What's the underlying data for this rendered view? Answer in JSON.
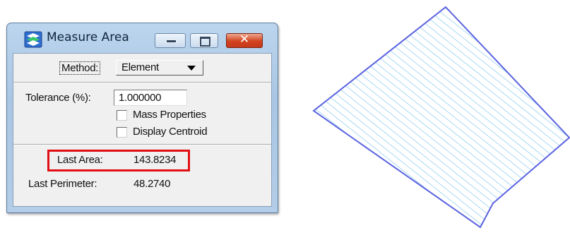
{
  "dialog": {
    "title": "Measure Area",
    "method_label": "Method:",
    "method_value": "Element",
    "tolerance_label": "Tolerance (%):",
    "tolerance_value": "1.000000",
    "mass_properties_label": "Mass Properties",
    "mass_properties_checked": false,
    "display_centroid_label": "Display Centroid",
    "display_centroid_checked": false,
    "last_area_label": "Last Area:",
    "last_area_value": "143.8234",
    "last_perimeter_label": "Last Perimeter:",
    "last_perimeter_value": "48.2740",
    "highlight_color": "#e10f13"
  },
  "window_buttons": {
    "minimize_icon": "minimize-icon",
    "maximize_icon": "maximize-icon",
    "close_icon": "close-icon",
    "close_glyph": "✕"
  },
  "measured_shape": {
    "outline_color": "#5a63e0",
    "hatch_color": "#a9d9f2"
  }
}
